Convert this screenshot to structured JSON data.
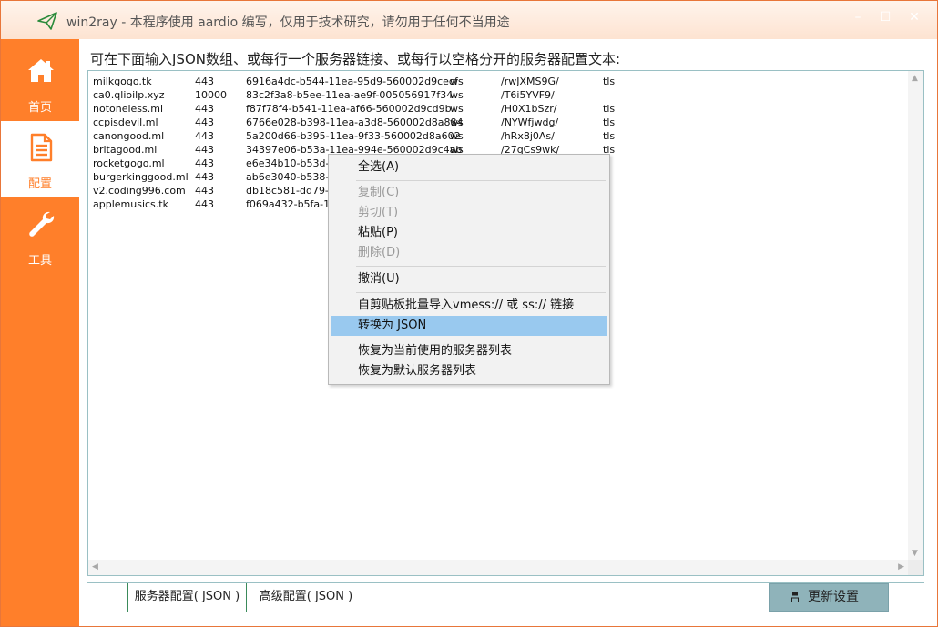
{
  "window": {
    "title": "win2ray - 本程序使用 aardio 编写，仅用于技术研究，请勿用于任何不当用途",
    "min_glyph": "–",
    "max_glyph": "☐",
    "close_glyph": "✕"
  },
  "sidebar": {
    "items": [
      {
        "label": "首页",
        "icon": "home-icon"
      },
      {
        "label": "配置",
        "icon": "document-icon"
      },
      {
        "label": "工具",
        "icon": "wrench-icon"
      }
    ]
  },
  "main": {
    "heading": "可在下面输入JSON数组、或每行一个服务器链接、或每行以空格分开的服务器配置文本:",
    "rows": [
      [
        "milkgogo.tk",
        "443",
        "6916a4dc-b544-11ea-95d9-560002d9cecf",
        "ws",
        "/rwJXMS9G/",
        "tls"
      ],
      [
        "ca0.qlioilp.xyz",
        "10000",
        "83c2f3a8-b5ee-11ea-ae9f-005056917f34",
        "ws",
        "/T6i5YVF9/",
        ""
      ],
      [
        "notoneless.ml",
        "443",
        "f87f78f4-b541-11ea-af66-560002d9cd9b",
        "ws",
        "/H0X1bSzr/",
        "tls"
      ],
      [
        "ccpisdevil.ml",
        "443",
        "6766e028-b398-11ea-a3d8-560002d8a884",
        "ws",
        "/NYWfjwdg/",
        "tls"
      ],
      [
        "canongood.ml",
        "443",
        "5a200d66-b395-11ea-9f33-560002d8a602",
        "ws",
        "/hRx8j0As/",
        "tls"
      ],
      [
        "britagood.ml",
        "443",
        "34397e06-b53a-11ea-994e-560002d9c4ab",
        "ws",
        "/27qCs9wk/",
        "tls"
      ],
      [
        "rocketgogo.ml",
        "443",
        "e6e34b10-b53d-1",
        "",
        "",
        "s"
      ],
      [
        "burgerkinggood.ml",
        "443",
        "ab6e3040-b538-1",
        "",
        "",
        "s"
      ],
      [
        "v2.coding996.com",
        "443",
        "db18c581-dd79-4",
        "",
        "",
        ""
      ],
      [
        "applemusics.tk",
        "443",
        "f069a432-b5fa-11",
        "",
        "",
        "s"
      ]
    ]
  },
  "tabs": [
    {
      "label": "服务器配置( JSON )"
    },
    {
      "label": "高级配置( JSON )"
    }
  ],
  "update_button": {
    "label": "更新设置"
  },
  "context_menu": {
    "items": [
      {
        "label": "全选(A)"
      },
      {
        "label": "复制(C)"
      },
      {
        "label": "剪切(T)"
      },
      {
        "label": "粘贴(P)"
      },
      {
        "label": "删除(D)"
      },
      {
        "label": "撤消(U)"
      },
      {
        "label": "自剪贴板批量导入vmess:// 或 ss:// 链接"
      },
      {
        "label": "转换为 JSON"
      },
      {
        "label": "恢复为当前使用的服务器列表"
      },
      {
        "label": "恢复为默认服务器列表"
      }
    ]
  },
  "colors": {
    "accent": "#ff7f2a",
    "menu_highlight": "#99c9ef",
    "button": "#8fb3ba"
  }
}
